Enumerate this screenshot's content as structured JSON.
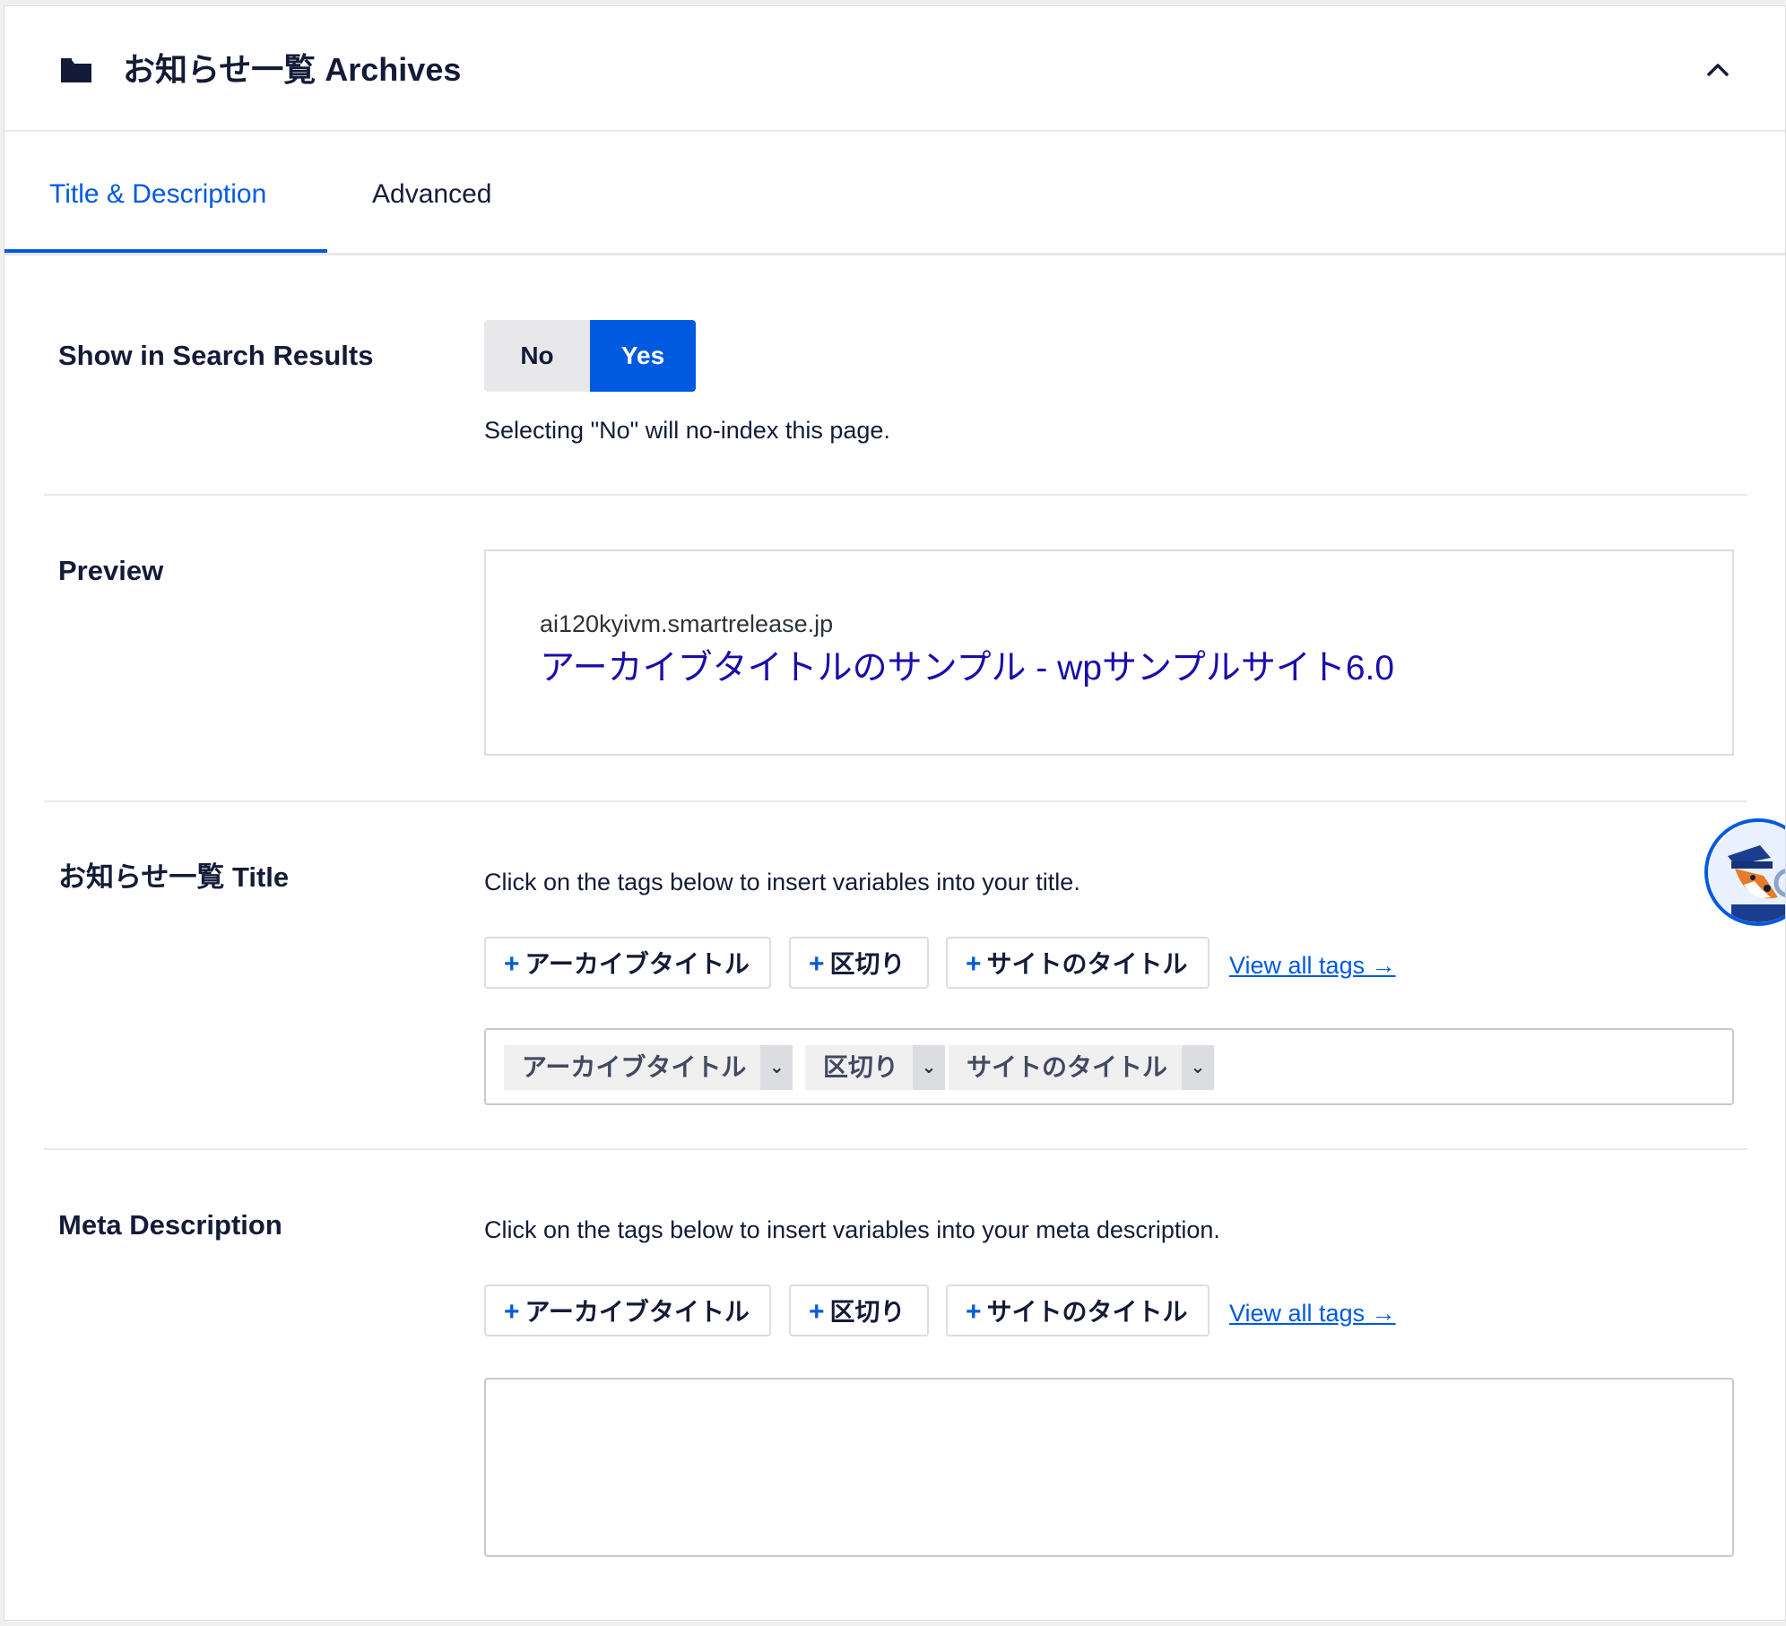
{
  "header": {
    "title": "お知らせ一覧 Archives",
    "folder_icon": "folder-icon",
    "collapse_icon": "chevron-up-icon"
  },
  "tabs": [
    {
      "label": "Title & Description",
      "active": true
    },
    {
      "label": "Advanced",
      "active": false
    }
  ],
  "search_results": {
    "label": "Show in Search Results",
    "options": [
      "No",
      "Yes"
    ],
    "selected": "Yes",
    "help": "Selecting \"No\" will no-index this page."
  },
  "preview": {
    "label": "Preview",
    "url": "ai120kyivm.smartrelease.jp",
    "title": "アーカイブタイトルのサンプル - wpサンプルサイト6.0"
  },
  "title_section": {
    "label": "お知らせ一覧 Title",
    "help": "Click on the tags below to insert variables into your title.",
    "tags": [
      "アーカイブタイトル",
      "区切り",
      "サイトのタイトル"
    ],
    "view_all": "View all tags →",
    "chips": [
      "アーカイブタイトル",
      "区切り",
      "サイトのタイトル"
    ]
  },
  "meta_section": {
    "label": "Meta Description",
    "help": "Click on the tags below to insert variables into your meta description.",
    "tags": [
      "アーカイブタイトル",
      "区切り",
      "サイトのタイトル"
    ],
    "view_all": "View all tags →",
    "value": ""
  },
  "colors": {
    "accent": "#005ae0",
    "serp_title": "#1a0dab",
    "text": "#141b38"
  }
}
